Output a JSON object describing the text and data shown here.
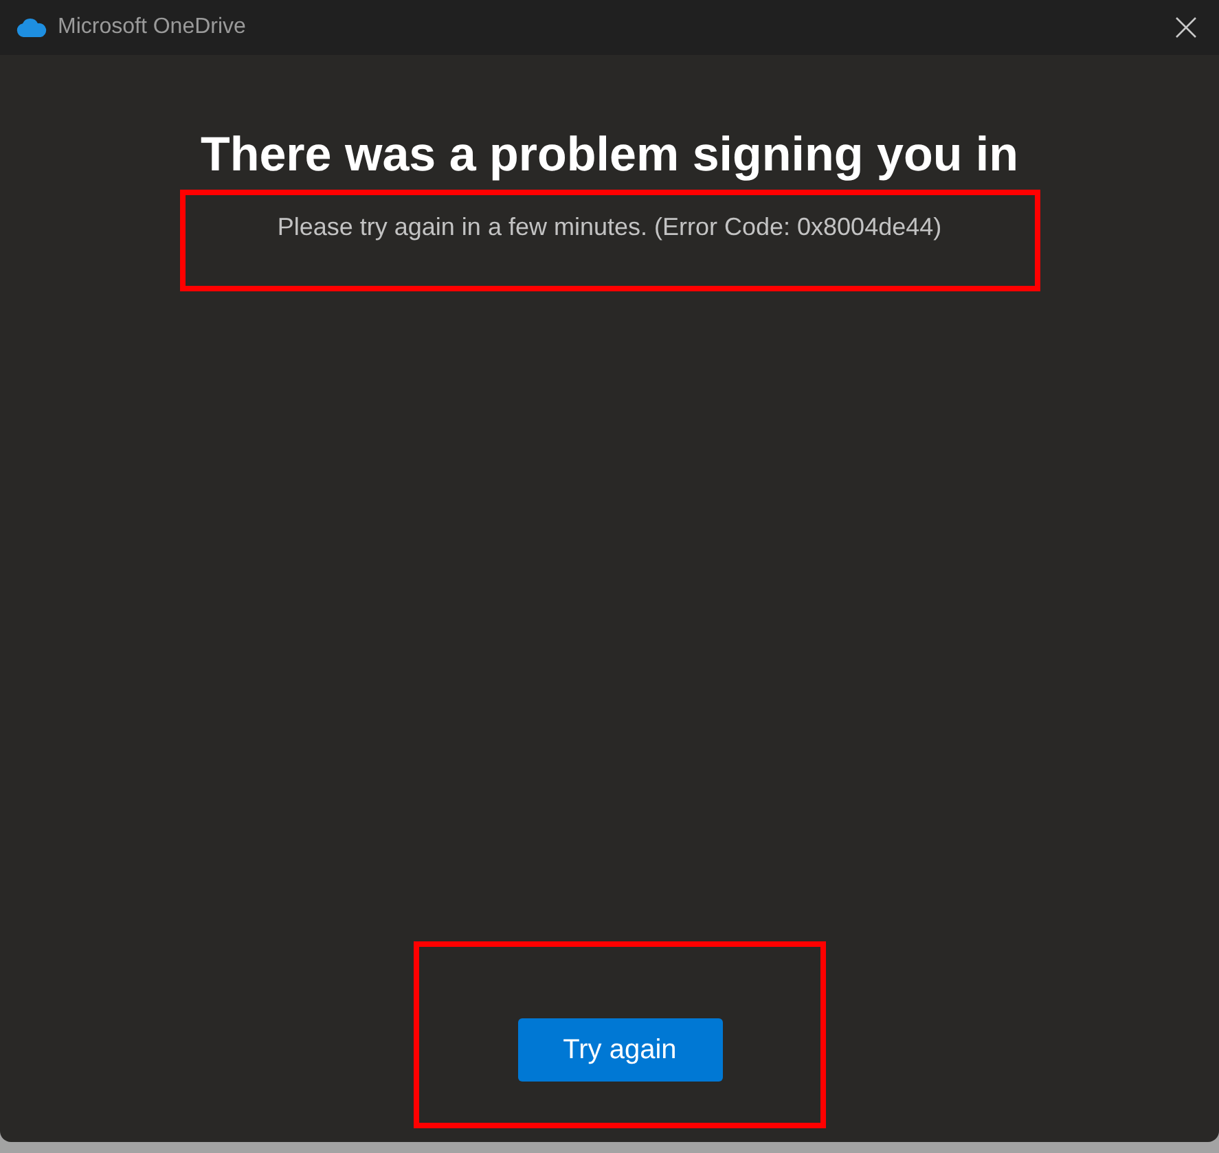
{
  "window": {
    "title": "Microsoft OneDrive"
  },
  "heading": "There was a problem signing you in",
  "message": {
    "text": "Please try again in a few minutes. (Error Code: 0x8004de44)",
    "highlighted": true
  },
  "button": {
    "label": "Try again",
    "highlighted": true
  }
}
